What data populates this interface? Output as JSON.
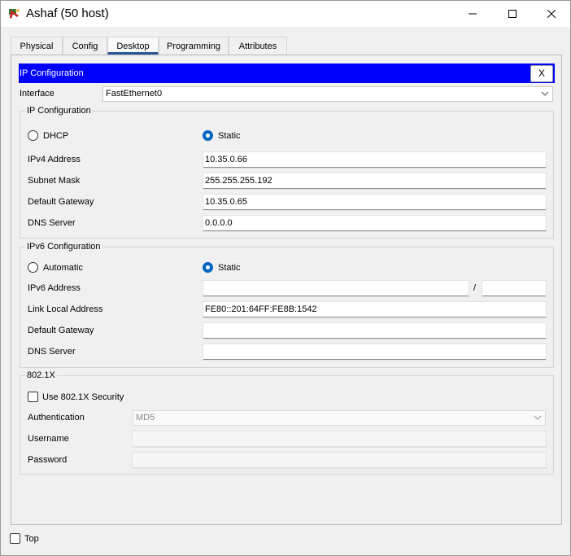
{
  "window": {
    "title": "Ashaf (50 host)"
  },
  "tabs": [
    "Physical",
    "Config",
    "Desktop",
    "Programming",
    "Attributes"
  ],
  "header": {
    "title": "IP Configuration",
    "close_label": "X"
  },
  "interface": {
    "label": "Interface",
    "value": "FastEthernet0"
  },
  "ipv4": {
    "group_title": "IP Configuration",
    "dhcp_label": "DHCP",
    "static_label": "Static",
    "mode": "static",
    "fields": [
      {
        "label": "IPv4 Address",
        "value": "10.35.0.66"
      },
      {
        "label": "Subnet Mask",
        "value": "255.255.255.192"
      },
      {
        "label": "Default Gateway",
        "value": "10.35.0.65"
      },
      {
        "label": "DNS Server",
        "value": "0.0.0.0"
      }
    ]
  },
  "ipv6": {
    "group_title": "IPv6 Configuration",
    "automatic_label": "Automatic",
    "static_label": "Static",
    "mode": "static",
    "address_label": "IPv6 Address",
    "address_value": "",
    "prefix_separator": "/",
    "prefix_value": "",
    "link_local_label": "Link Local Address",
    "link_local_value": "FE80::201:64FF:FE8B:1542",
    "gateway_label": "Default Gateway",
    "gateway_value": "",
    "dns_label": "DNS Server",
    "dns_value": ""
  },
  "dot1x": {
    "group_title": "802.1X",
    "use_security_label": "Use 802.1X Security",
    "use_security_checked": false,
    "authentication_label": "Authentication",
    "authentication_value": "MD5",
    "username_label": "Username",
    "username_value": "",
    "password_label": "Password",
    "password_value": ""
  },
  "footer": {
    "top_label": "Top",
    "top_checked": false
  }
}
